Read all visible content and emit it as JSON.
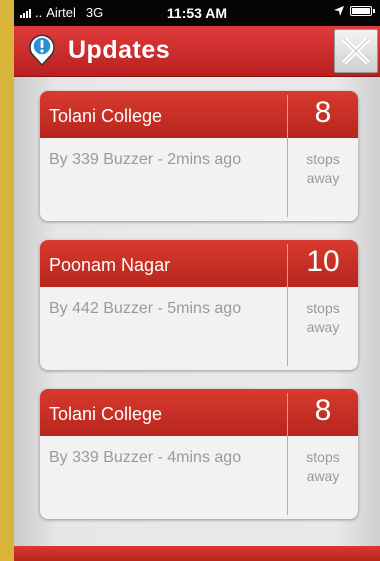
{
  "status_bar": {
    "carrier": "Airtel",
    "network": "3G",
    "time": "11:53 AM"
  },
  "header": {
    "title": "Updates",
    "accent_color": "#d32f2f"
  },
  "cards": [
    {
      "place": "Tolani College",
      "count": "8",
      "by": "By 339 Buzzer - 2mins ago",
      "stops_line1": "stops",
      "stops_line2": "away"
    },
    {
      "place": "Poonam Nagar",
      "count": "10",
      "by": "By 442 Buzzer - 5mins ago",
      "stops_line1": "stops",
      "stops_line2": "away"
    },
    {
      "place": "Tolani College",
      "count": "8",
      "by": "By 339 Buzzer - 4mins ago",
      "stops_line1": "stops",
      "stops_line2": "away"
    }
  ],
  "icons": {
    "alert": "alert-pin-icon",
    "close": "close-icon",
    "location": "location-arrow-icon",
    "battery": "battery-icon",
    "signal": "signal-icon"
  }
}
